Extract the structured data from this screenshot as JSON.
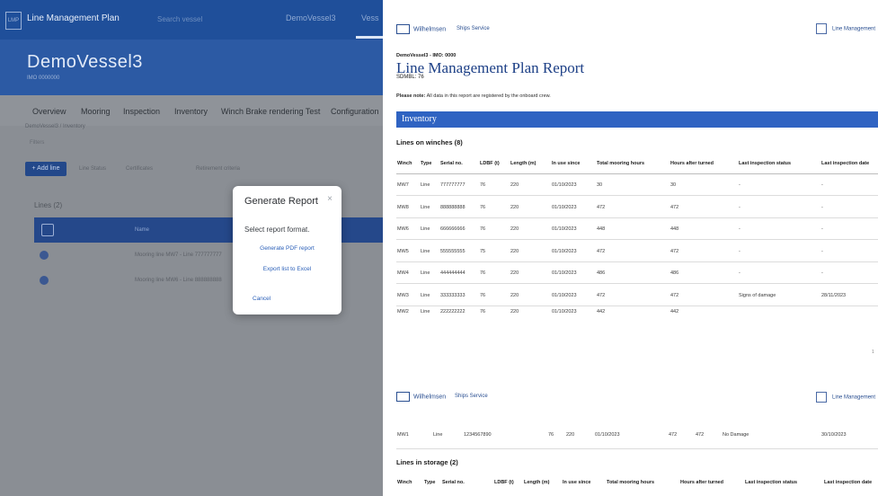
{
  "app": {
    "logo_text": "LMP",
    "title": "Line Management Plan",
    "search_placeholder": "Search vessel",
    "vessel_select": "DemoVessel3",
    "vessel_select_2": "Vess",
    "vessel_name": "DemoVessel3",
    "vessel_sub": "IMO 0000000",
    "tabs": [
      "Overview",
      "Mooring",
      "Inspection",
      "Inventory",
      "Winch Brake rendering Test",
      "Configuration"
    ],
    "breadcrumb": "DemoVessel3 / Inventory",
    "filter_label": "Filters",
    "add_button": "+ Add line",
    "chips": [
      "Line Status",
      "Certificates",
      "Retirement criteria"
    ],
    "list_header": "Lines (2)",
    "rows": [
      "Name",
      "Mooring line MW7 - Line 777777777",
      "Mooring line MW6 - Line 888888888"
    ]
  },
  "modal": {
    "title": "Generate Report",
    "close": "×",
    "prompt": "Select report format.",
    "pdf_link": "Generate PDF report",
    "excel_link": "Export list to Excel",
    "cancel": "Cancel"
  },
  "report": {
    "logo": "Wilhelmsen",
    "service": "Ships Service",
    "right_label": "Line Management",
    "vessel_line": "DemoVessel3 - IMO: 0000",
    "title": "Line Management Plan Report",
    "sdmbl": "SDMBL: 76",
    "note_label": "Please note:",
    "note_text": "All data in this report are registered by the onboard crew.",
    "section": "Inventory",
    "winch_heading": "Lines on winches (8)",
    "columns": [
      "Winch",
      "Type",
      "Serial no.",
      "LDBF (t)",
      "Length (m)",
      "In use since",
      "Total mooring hours",
      "Hours after turned",
      "Last inspection status",
      "Last inspection date"
    ],
    "rows": [
      [
        "MW7",
        "Line",
        "777777777",
        "76",
        "220",
        "01/10/2023",
        "30",
        "30",
        "-",
        "-"
      ],
      [
        "MW8",
        "Line",
        "888888888",
        "76",
        "220",
        "01/10/2023",
        "472",
        "472",
        "-",
        "-"
      ],
      [
        "MW6",
        "Line",
        "666666666",
        "76",
        "220",
        "01/10/2023",
        "448",
        "448",
        "-",
        "-"
      ],
      [
        "MW5",
        "Line",
        "555555555",
        "75",
        "220",
        "01/10/2023",
        "472",
        "472",
        "-",
        "-"
      ],
      [
        "MW4",
        "Line",
        "444444444",
        "76",
        "220",
        "01/10/2023",
        "486",
        "486",
        "-",
        "-"
      ],
      [
        "MW3",
        "Line",
        "333333333",
        "76",
        "220",
        "01/10/2023",
        "472",
        "472",
        "Signs of damage",
        "28/11/2023"
      ],
      [
        "MW2",
        "Line",
        "222222222",
        "76",
        "220",
        "01/10/2023",
        "442",
        "442",
        "",
        ""
      ]
    ],
    "page_number": "1",
    "page2_row": [
      "MW1",
      "Line",
      "1234567890",
      "76",
      "220",
      "01/10/2023",
      "472",
      "472",
      "No Damage",
      "30/10/2023"
    ],
    "storage_heading": "Lines in storage (2)",
    "storage_columns": [
      "Winch",
      "Type",
      "Serial no.",
      "LDBF (t)",
      "Length (m)",
      "In use since",
      "Total mooring hours",
      "Hours after turned",
      "Last inspection status",
      "Last inspection date"
    ]
  }
}
